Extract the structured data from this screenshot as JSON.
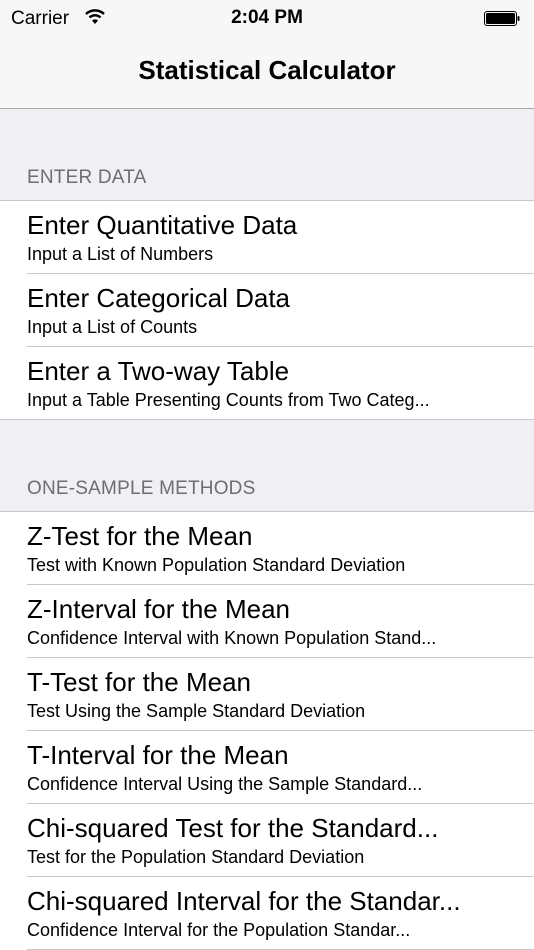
{
  "status_bar": {
    "carrier": "Carrier",
    "time": "2:04 PM",
    "wifi_icon": "wifi-icon",
    "battery_icon": "battery-icon"
  },
  "nav": {
    "title": "Statistical Calculator"
  },
  "sections": [
    {
      "header": "ENTER DATA",
      "rows": [
        {
          "title": "Enter Quantitative Data",
          "subtitle": "Input a List of Numbers"
        },
        {
          "title": "Enter Categorical Data",
          "subtitle": "Input a List of Counts"
        },
        {
          "title": "Enter a Two-way Table",
          "subtitle": "Input a Table Presenting Counts from Two Categ..."
        }
      ]
    },
    {
      "header": "ONE-SAMPLE METHODS",
      "rows": [
        {
          "title": "Z-Test for the Mean",
          "subtitle": "Test with Known Population Standard Deviation"
        },
        {
          "title": "Z-Interval for the Mean",
          "subtitle": "Confidence Interval with Known Population Stand..."
        },
        {
          "title": "T-Test for the Mean",
          "subtitle": "Test Using the Sample Standard Deviation"
        },
        {
          "title": "T-Interval for the Mean",
          "subtitle": "Confidence Interval Using the Sample Standard..."
        },
        {
          "title": "Chi-squared Test for the Standard...",
          "subtitle": "Test for the Population Standard Deviation"
        },
        {
          "title": "Chi-squared Interval for the Standar...",
          "subtitle": "Confidence Interval for the Population Standar..."
        }
      ]
    }
  ]
}
